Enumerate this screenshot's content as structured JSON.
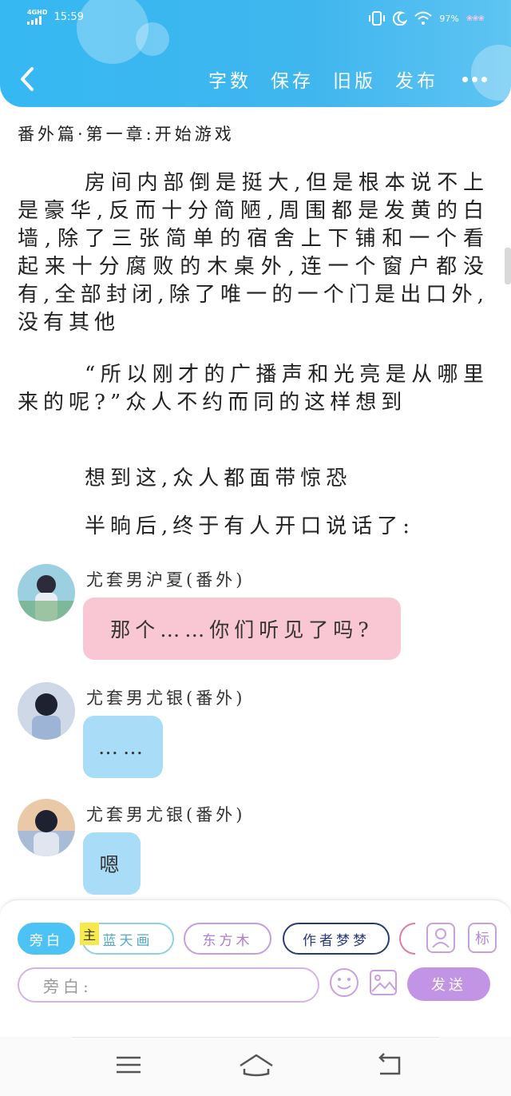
{
  "status_bar": {
    "network": "4GHD",
    "time": "15:59",
    "battery": "97%",
    "carrier": "❀❀❀"
  },
  "toolbar": {
    "word_count": "字数",
    "save": "保存",
    "old_version": "旧版",
    "publish": "发布"
  },
  "chapter": {
    "title": "番外篇·第一章:开始游戏",
    "paragraphs": [
      "房间内部倒是挺大,但是根本说不上是豪华,反而十分简陋,周围都是发黄的白墙,除了三张简单的宿舍上下铺和一个看起来十分腐败的木桌外,连一个窗户都没有,全部封闭,除了唯一的一个门是出口外,没有其他",
      "“所以刚才的广播声和光亮是从哪里来的呢?”众人不约而同的这样想到",
      "想到这,众人都面带惊恐",
      "半晌后,终于有人开口说话了:"
    ]
  },
  "messages": [
    {
      "name": "尤套男沪夏(番外)",
      "text": "那个……你们听见了吗?",
      "color": "#f8c7d3"
    },
    {
      "name": "尤套男尤银(番外)",
      "text": "……",
      "color": "#a9dcf7"
    },
    {
      "name": "尤套男尤银(番外)",
      "text": "嗯",
      "color": "#a9dcf7"
    }
  ],
  "roles": {
    "narrator": "旁白",
    "main_tag": "主",
    "lantian": "蓝天画",
    "dongfang": "东方木",
    "author": "作者梦梦",
    "mark": "标"
  },
  "input": {
    "placeholder": "旁白:",
    "send": "发送"
  },
  "colors": {
    "header": "#3fb6ee",
    "send_button": "#c294e6",
    "narrator_chip": "#4cc3f4"
  }
}
